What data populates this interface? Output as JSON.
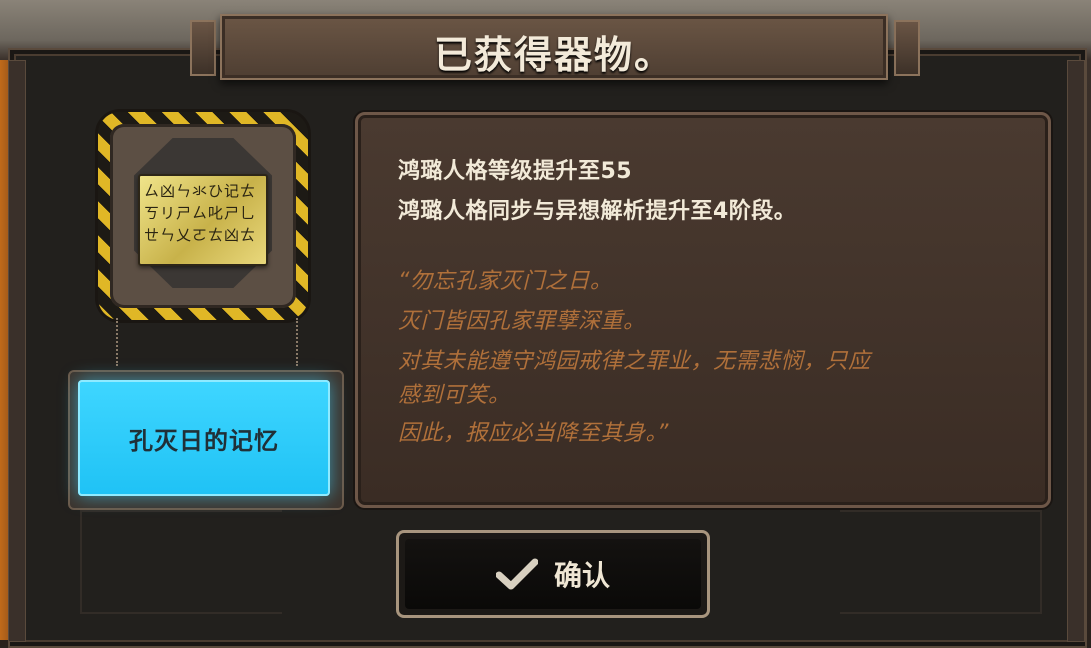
{
  "title": "已获得器物。",
  "item": {
    "icon": "stone-tablet-icon",
    "tablet_lines": [
      "ㄙ凶ㄣ氺ひ记ㄊ",
      "ㄎリㄕㄙ叱ㄕ乚",
      "ㄝㄣ乂ㄛㄊ凶ㄊ"
    ],
    "name": "孔灭日的记忆",
    "accent_color": "#2ccdfa"
  },
  "description": {
    "lines": [
      "鸿璐人格等级提升至55",
      "鸿璐人格同步与异想解析提升至4阶段。"
    ],
    "quote_lines": [
      "“勿忘孔家灭门之日。",
      "灭门皆因孔家罪孽深重。",
      "对其未能遵守鸿园戒律之罪业，无需悲悯，只应",
      "感到可笑。",
      "因此，报应必当降至其身。”"
    ],
    "quote_color": "#b0703a"
  },
  "confirm": {
    "icon": "checkmark-icon",
    "label": "确认"
  }
}
